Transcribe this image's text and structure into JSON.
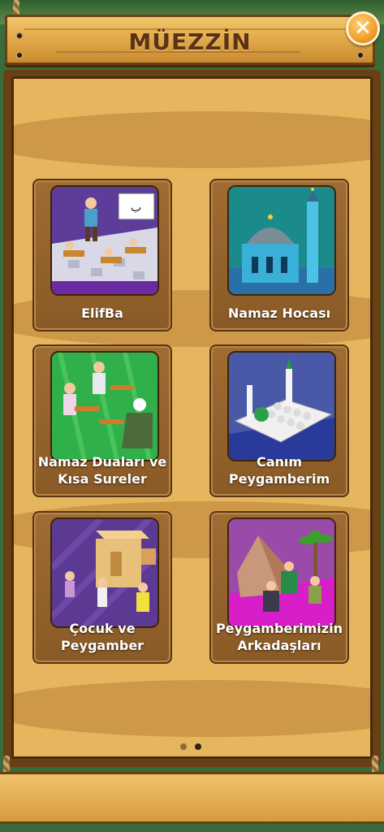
{
  "header": {
    "title": "MÜEZZİN",
    "close_label": "✕"
  },
  "menu": {
    "items": [
      {
        "label": "ElifBa",
        "icon": "classroom-icon"
      },
      {
        "label": "Namaz Hocası",
        "icon": "mosque-icon"
      },
      {
        "label": "Namaz Duaları ve Kısa Sureler",
        "icon": "prayer-icon"
      },
      {
        "label": "Canım Peygamberim",
        "icon": "green-dome-mosque-icon"
      },
      {
        "label": "Çocuk ve Peygamber",
        "icon": "children-house-icon"
      },
      {
        "label": "Peygamberimizin Arkadaşları",
        "icon": "desert-tent-icon"
      }
    ]
  },
  "pagination": {
    "current": 2,
    "total": 2
  }
}
